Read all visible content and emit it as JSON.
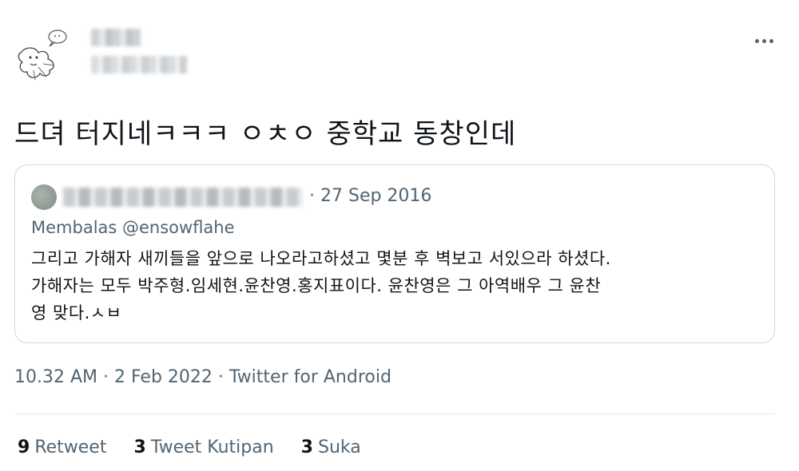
{
  "tweet": {
    "text": "드뎌 터지네ㅋㅋㅋ ㅇㅊㅇ 중학교 동창인데",
    "timestamp": "10.32 AM · 2 Feb 2022 · ",
    "source": "Twitter for Android"
  },
  "quote": {
    "date": "· 27 Sep 2016",
    "author": "Membalas @ensowflahe",
    "lines": [
      "그리고 가해자 새끼들을 앞으로 나오라고하셨고 몇분 후 벽보고 서있으라 하셨다.",
      "가해자는 모두 박주형.임세현.윤찬영.홍지표이다. 윤찬영은 그 아역배우 그 윤찬",
      "영 맞다.ㅅㅂ"
    ]
  },
  "stats": {
    "retweets": {
      "count": "9",
      "label": "Retweet"
    },
    "quotes": {
      "count": "3",
      "label": "Tweet Kutipan"
    },
    "likes": {
      "count": "3",
      "label": "Suka"
    }
  },
  "icons": {
    "more": "more-horizontal-icon",
    "avatar": "sketch-avatar"
  },
  "colors": {
    "text": "#0f1419",
    "secondary": "#536471",
    "border": "#cfd9de"
  }
}
